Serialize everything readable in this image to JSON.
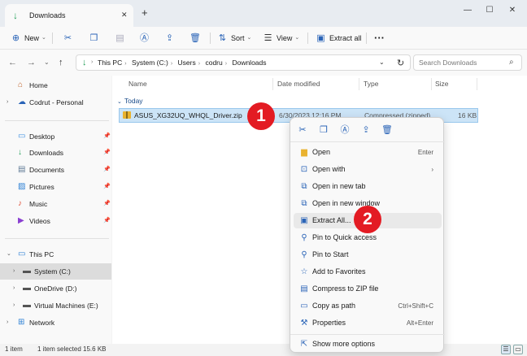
{
  "tab": {
    "title": "Downloads"
  },
  "toolbar": {
    "new_label": "New",
    "sort_label": "Sort",
    "view_label": "View",
    "extract_all_label": "Extract all"
  },
  "address": {
    "crumbs": [
      "This PC",
      "System (C:)",
      "Users",
      "codru",
      "Downloads"
    ]
  },
  "search": {
    "placeholder": "Search Downloads"
  },
  "sidebar": {
    "home": "Home",
    "codrut": "Codrut - Personal",
    "desktop": "Desktop",
    "downloads": "Downloads",
    "documents": "Documents",
    "pictures": "Pictures",
    "music": "Music",
    "videos": "Videos",
    "this_pc": "This PC",
    "system_c": "System (C:)",
    "onedrive": "OneDrive (D:)",
    "vms": "Virtual Machines (E:)",
    "network": "Network"
  },
  "columns": {
    "name": "Name",
    "date": "Date modified",
    "type": "Type",
    "size": "Size"
  },
  "group": {
    "label": "Today"
  },
  "file": {
    "name": "ASUS_XG32UQ_WHQL_Driver.zip",
    "date": "6/30/2023 12:16 PM",
    "type": "Compressed (zipped)",
    "size": "16 KB"
  },
  "status": {
    "count": "1 item",
    "selected": "1 item selected  15.6 KB"
  },
  "context_menu": {
    "open": "Open",
    "open_shortcut": "Enter",
    "open_with": "Open with",
    "open_new_tab": "Open in new tab",
    "open_new_window": "Open in new window",
    "extract_all": "Extract All...",
    "pin_quick": "Pin to Quick access",
    "pin_start": "Pin to Start",
    "add_fav": "Add to Favorites",
    "compress": "Compress to ZIP file",
    "copy_path": "Copy as path",
    "copy_path_shortcut": "Ctrl+Shift+C",
    "properties": "Properties",
    "properties_shortcut": "Alt+Enter",
    "more": "Show more options"
  },
  "badges": {
    "one": "1",
    "two": "2"
  },
  "colors": {
    "accent": "#2a64b7",
    "selection": "#cce4f7",
    "badge": "#e31b23"
  }
}
